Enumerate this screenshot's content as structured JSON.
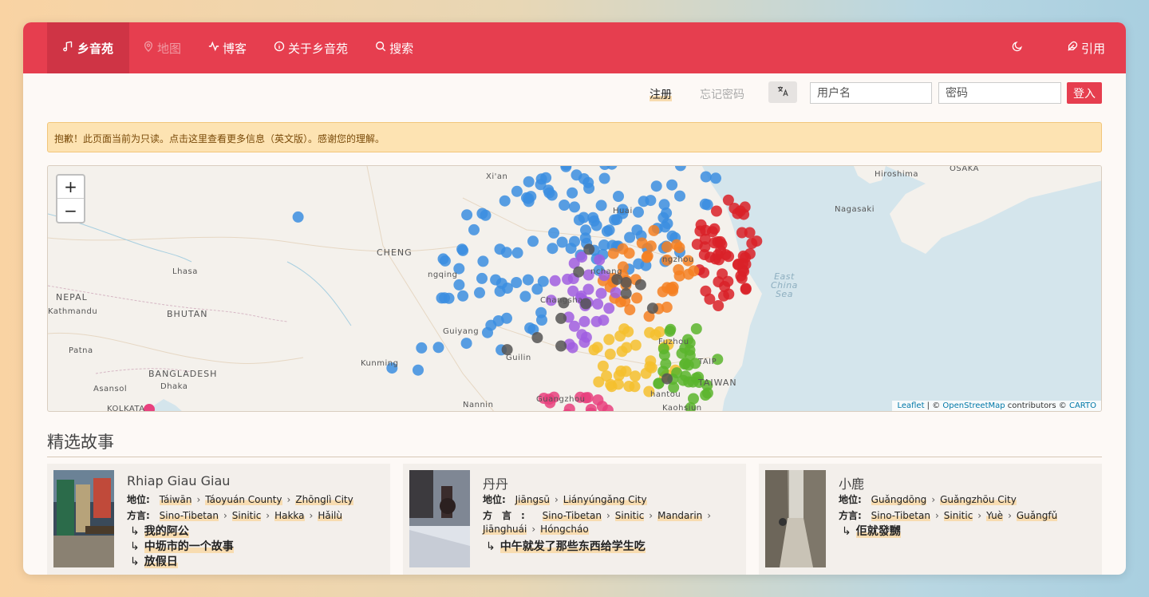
{
  "nav": {
    "brand": "乡音苑",
    "map": "地图",
    "blog": "博客",
    "about": "关于乡音苑",
    "search": "搜索",
    "cite": "引用"
  },
  "login": {
    "register": "注册",
    "forgot": "忘记密码",
    "translate_icon": "translate-icon",
    "username_placeholder": "用户名",
    "password_placeholder": "密码",
    "submit": "登入"
  },
  "alert": "抱歉！此页面当前为只读。点击这里查看更多信息（英文版）。感谢您的理解。",
  "map": {
    "zoom_in": "+",
    "zoom_out": "−",
    "labels": {
      "xian": "Xi'an",
      "hiroshima": "Hiroshima",
      "osaka": "OSAKA",
      "nagasaki": "Nagasaki",
      "chengdu": "CHENG",
      "chongqing": "ngqing",
      "lhasa": "Lhasa",
      "nepal": "NEPAL",
      "kathmandu": "Kathmandu",
      "bhutan": "BHUTAN",
      "patna": "Patna",
      "bangladesh": "BANGLADESH",
      "dhaka": "Dhaka",
      "asansol": "Asansol",
      "kolkata": "KOLKATA",
      "guiyang": "Guiyang",
      "kunming": "Kunming",
      "guilin": "Guilin",
      "nanning": "Nannin",
      "guangzhou": "Guangzhou",
      "shantou": "hantou",
      "kaohsiung": "Kaohsiun",
      "taiwan": "TAIWAN",
      "taipei": "TAIP",
      "fuzhou": "Fuzhou",
      "hangzhou": "ngzhou",
      "huaian": "Huai",
      "nanchang": "nchang",
      "changsha": "Changsha",
      "east_china_sea": [
        "East",
        "China",
        "Sea"
      ]
    },
    "attribution": {
      "leaflet": "Leaflet",
      "sep": " | © ",
      "osm": "OpenStreetMap",
      "contributors": " contributors © ",
      "carto": "CARTO"
    },
    "colors": {
      "blue": "#3b8ee0",
      "red": "#d92128",
      "orange": "#f58022",
      "purple": "#a05ee0",
      "green": "#5bb52d",
      "yellow": "#f5c02e",
      "dark": "#555555",
      "pink": "#e8417e"
    }
  },
  "featured": {
    "title": "精选故事",
    "cards": [
      {
        "name": "Rhiap Giau Giau",
        "location_label": "地位:",
        "location": [
          "Táiwān",
          "Táoyuán County",
          "Zhōnglì City"
        ],
        "dialect_label": "方言:",
        "dialect": [
          "Sino-Tibetan",
          "Sinitic",
          "Hakka",
          "Hǎilù"
        ],
        "stories": [
          "我的阿公",
          "中坜市的一个故事",
          "放假日"
        ]
      },
      {
        "name": "丹丹",
        "location_label": "地位:",
        "location": [
          "Jiāngsū",
          "Liányúngǎng City"
        ],
        "dialect_label": "方　言　:",
        "dialect": [
          "Sino-Tibetan",
          "Sinitic",
          "Mandarin",
          "Jiānghuái",
          "Hóngcháo"
        ],
        "stories": [
          "中午就发了那些东西给学生吃"
        ]
      },
      {
        "name": "小鹿",
        "location_label": "地位:",
        "location": [
          "Guǎngdōng",
          "Guǎngzhōu City"
        ],
        "dialect_label": "方言:",
        "dialect": [
          "Sino-Tibetan",
          "Sinitic",
          "Yuè",
          "Guǎngfǔ"
        ],
        "stories": [
          "佢就發嬲"
        ]
      }
    ]
  }
}
